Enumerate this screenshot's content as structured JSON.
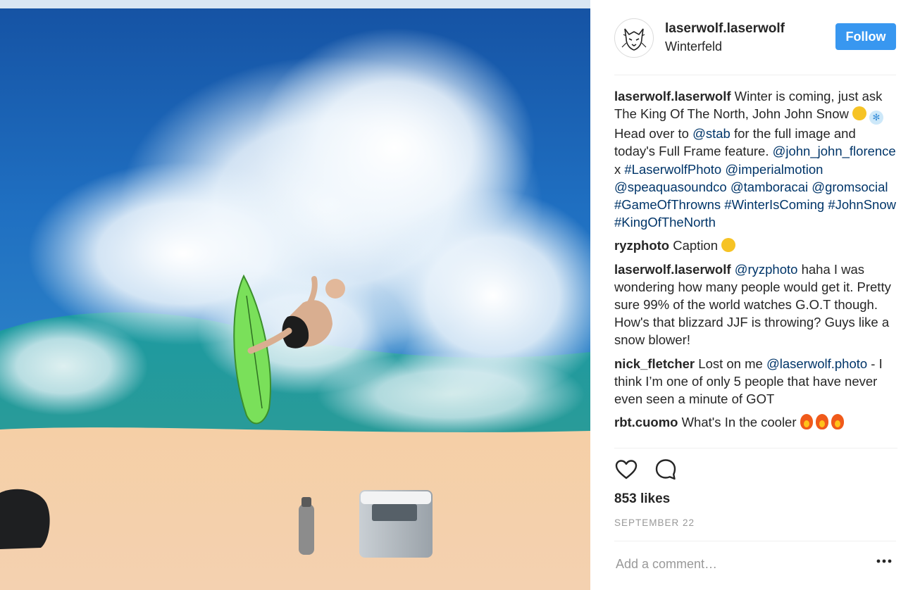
{
  "post": {
    "username": "laserwolf.laserwolf",
    "location": "Winterfeld",
    "follow_label": "Follow"
  },
  "caption": {
    "user": "laserwolf.laserwolf",
    "t1": " Winter is coming, just ask The King Of The North, John John Snow ",
    "t2": " Head over to ",
    "mention_stab": "@stab",
    "t3": " for the full image and today's Full Frame feature. ",
    "mention_jjf": "@john_john_florence",
    "t4": " x ",
    "tag_laserwolfphoto": "#LaserwolfPhoto",
    "mention_imperial": "@imperialmotion",
    "mention_speaqua": "@speaquasoundco",
    "mention_tambor": "@tamboracai",
    "mention_grom": "@gromsocial",
    "tag_got": "#GameOfThrowns",
    "tag_winter": "#WinterIsComing",
    "tag_snow": "#JohnSnow",
    "tag_king": "#KingOfTheNorth"
  },
  "comments": [
    {
      "user": "ryzphoto",
      "text": " Caption "
    },
    {
      "user": "laserwolf.laserwolf",
      "mention": "@ryzphoto",
      "text": " haha I was wondering how many people would get it. Pretty sure 99% of the world watches G.O.T though. How's that blizzard JJF is throwing? Guys like a snow blower!"
    },
    {
      "user": "nick_fletcher",
      "t1": " Lost on me ",
      "mention": "@laserwolf.photo",
      "t2": " - I think I’m one of only 5 people that have never even seen a minute of GOT"
    },
    {
      "user": "rbt.cuomo",
      "text": " What's In the cooler "
    }
  ],
  "likes": "853 likes",
  "date": "SEPTEMBER 22",
  "add_comment_placeholder": "Add a comment…",
  "icons": [
    "heart-icon",
    "comment-icon",
    "more-options-icon"
  ],
  "colors": {
    "follow": "#3897f0",
    "link": "#003569",
    "muted": "#999999"
  }
}
